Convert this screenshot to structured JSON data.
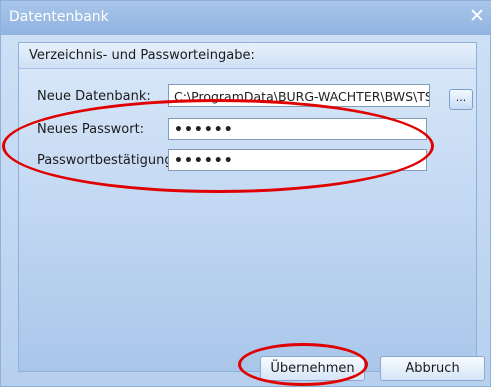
{
  "window": {
    "title": "Datentenbank"
  },
  "group": {
    "title": "Verzeichnis- und Passworteingabe:"
  },
  "form": {
    "db_label": "Neue Datenbank:",
    "db_value": "C:\\ProgramData\\BURG-WACHTER\\BWS\\TSE",
    "browse_label": "...",
    "pw_label": "Neues Passwort:",
    "pw_value": "••••••",
    "confirm_label": "Passwortbestätigung:",
    "confirm_value": "••••••"
  },
  "buttons": {
    "ok": "Übernehmen",
    "cancel": "Abbruch"
  },
  "annotations": {
    "color": "#e00000"
  }
}
